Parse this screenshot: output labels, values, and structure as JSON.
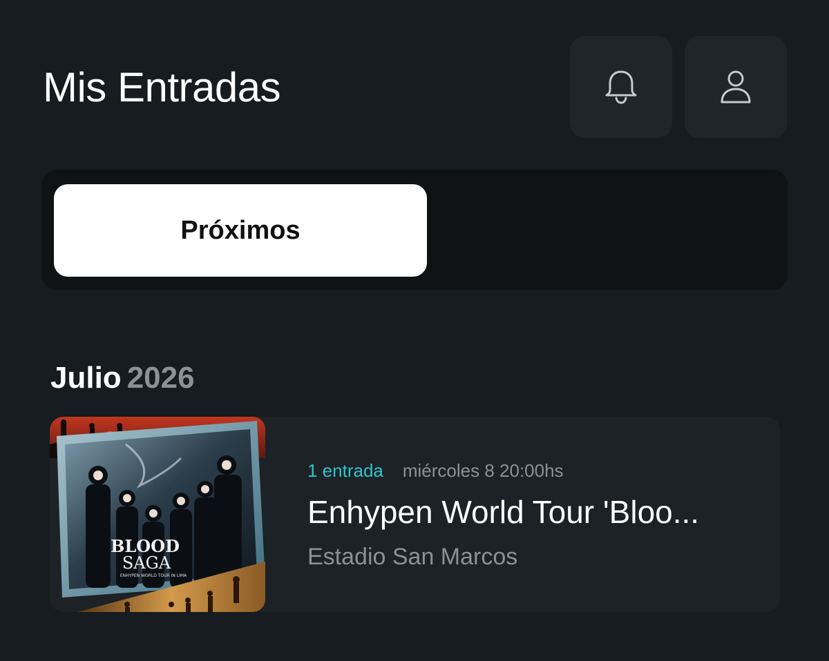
{
  "header": {
    "title": "Mis Entradas",
    "icons": [
      "bell-icon",
      "user-icon"
    ]
  },
  "tabs": {
    "active_label": "Próximos"
  },
  "section": {
    "month": "Julio",
    "year": "2026"
  },
  "event": {
    "tickets": "1 entrada",
    "datetime": "miércoles 8 20:00hs",
    "title": "Enhypen World Tour 'Bloo...",
    "venue": "Estadio San Marcos",
    "poster": {
      "logo_line1": "BLOOD",
      "logo_line2": "SAGA",
      "logo_subtitle": "ENHYPEN WORLD TOUR IN LIMA"
    }
  },
  "colors": {
    "background": "#161c1f",
    "card": "#1c2225",
    "accent": "#2ec4cf",
    "muted": "#8a9296"
  }
}
